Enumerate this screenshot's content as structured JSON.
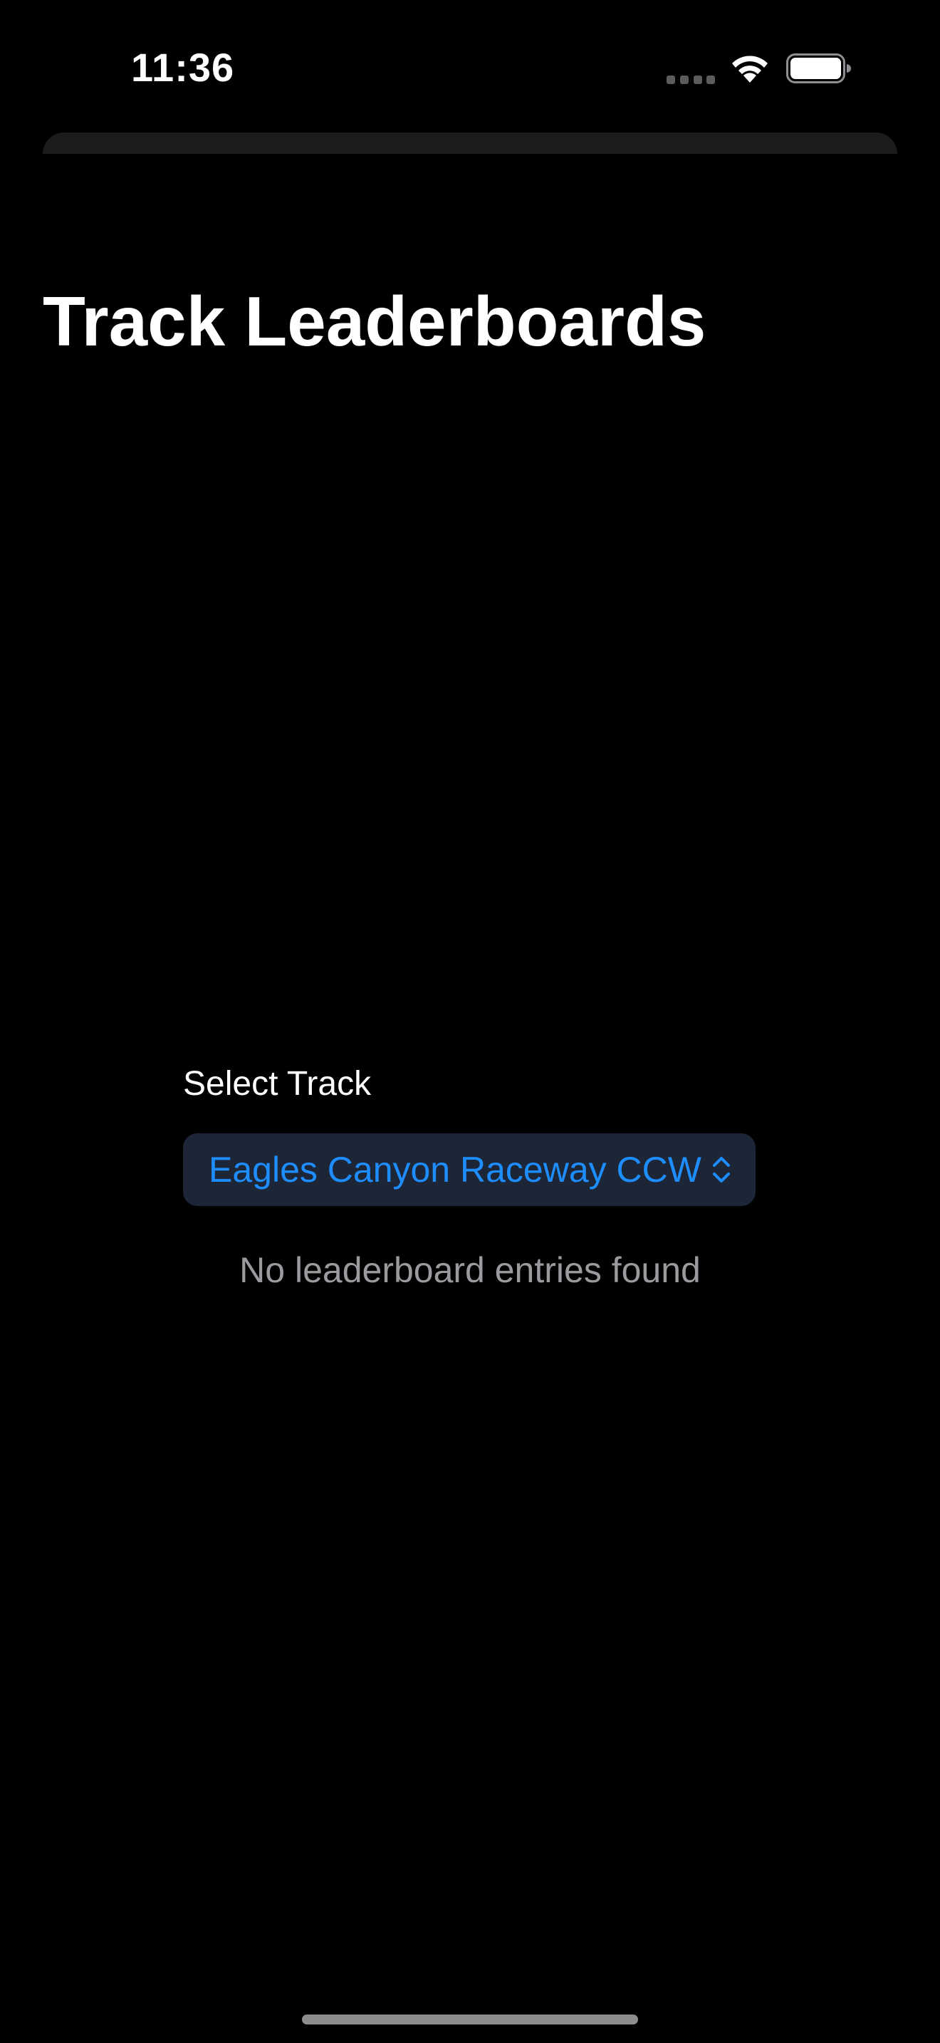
{
  "status_bar": {
    "time": "11:36"
  },
  "icons": {
    "cellular": "cellular-dots-icon",
    "wifi": "wifi-icon",
    "battery": "battery-icon",
    "picker_chevron": "chevron-up-down-icon"
  },
  "header": {
    "title": "Track Leaderboards"
  },
  "track_selector": {
    "label": "Select Track",
    "selected_value": "Eagles Canyon Raceway CCW"
  },
  "leaderboard": {
    "empty_message": "No leaderboard entries found"
  },
  "colors": {
    "background": "#000000",
    "accent": "#1e8dff",
    "picker_background": "#1c2636",
    "secondary_text": "#9a9a9f"
  }
}
